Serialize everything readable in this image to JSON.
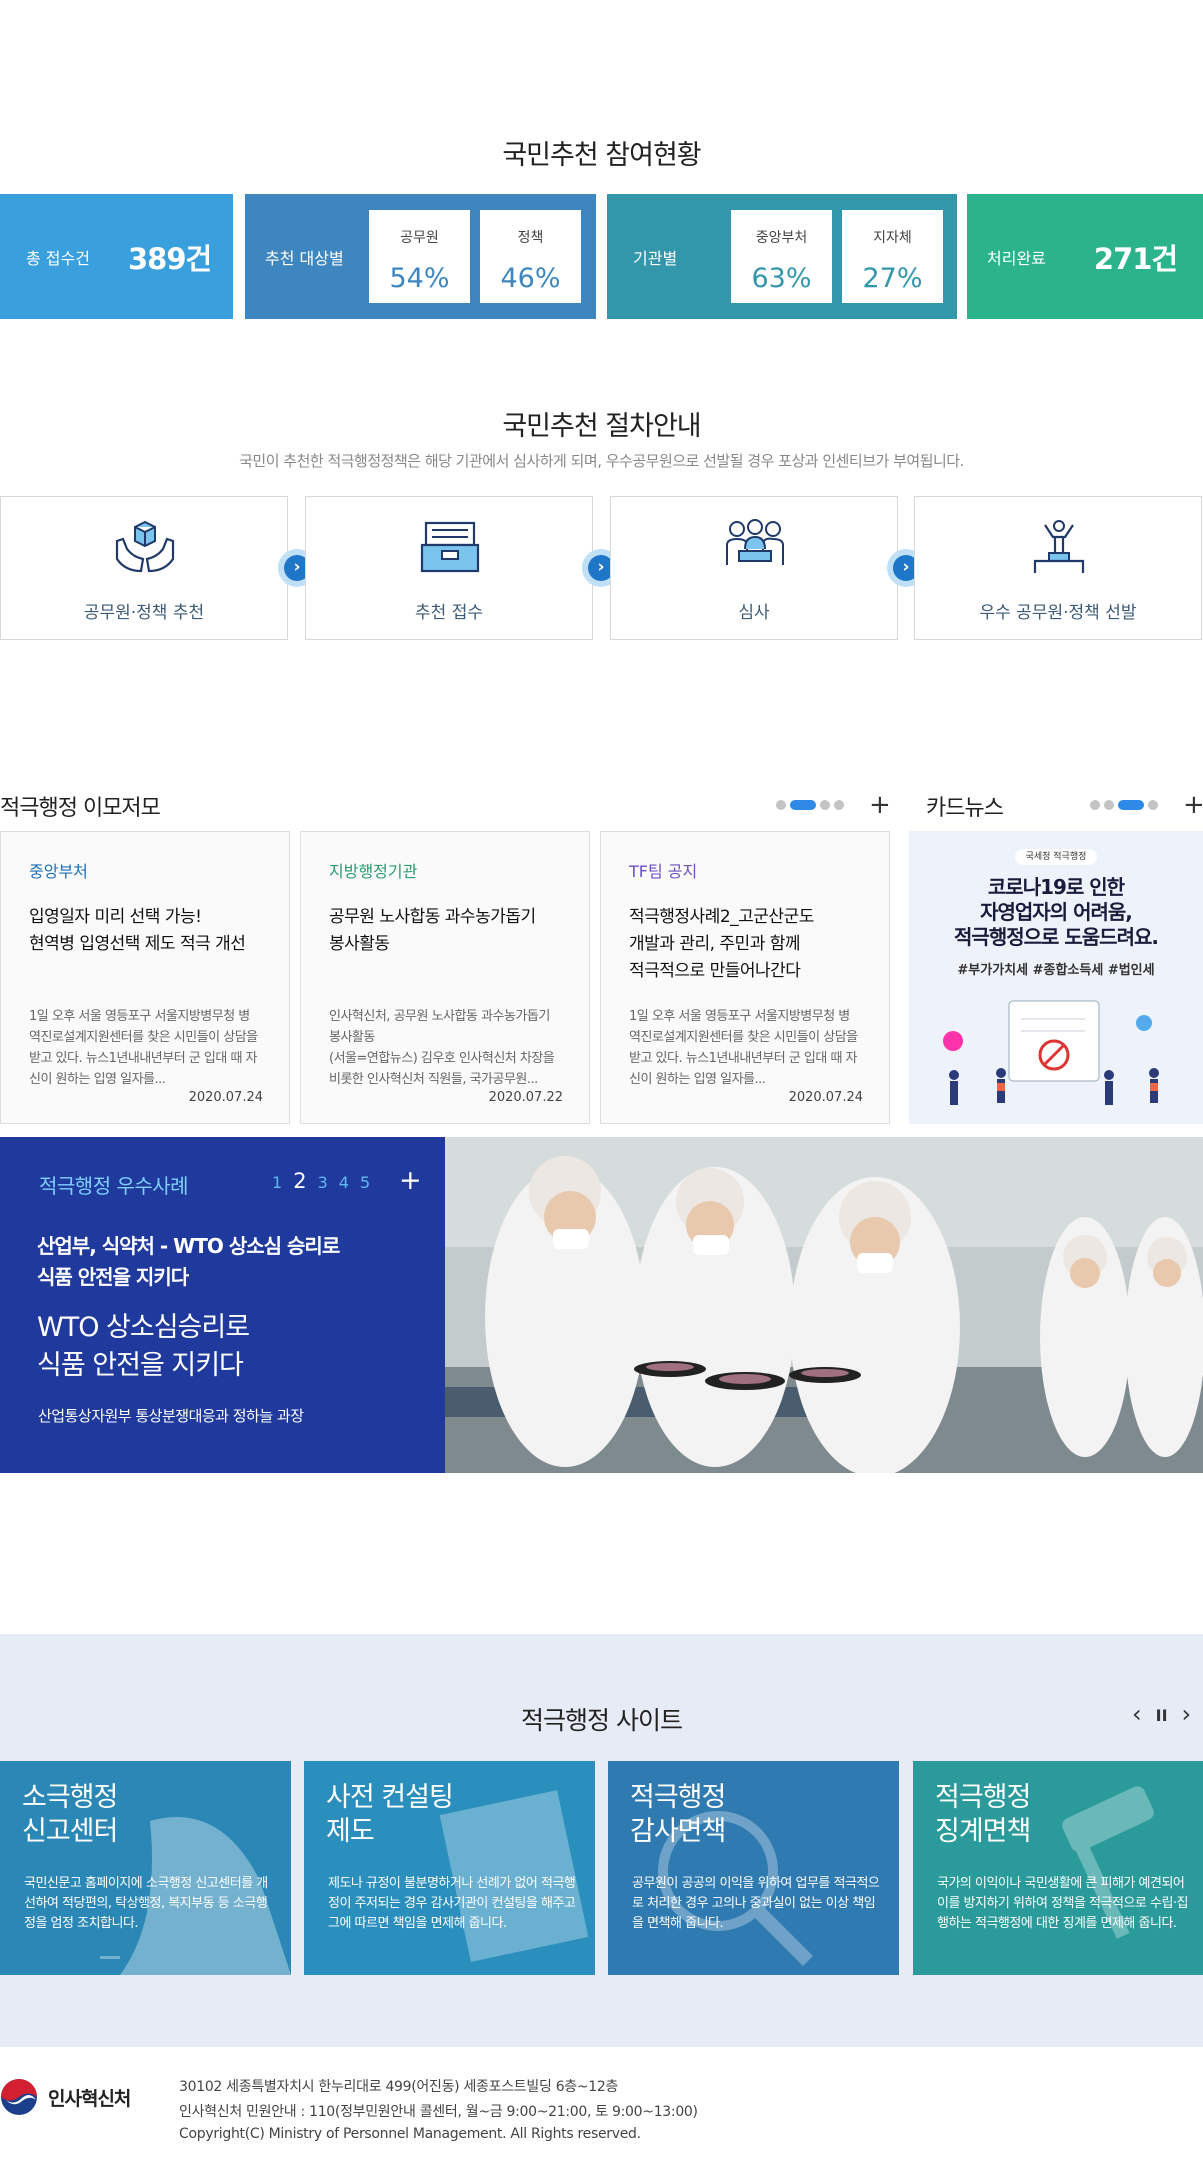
{
  "participation": {
    "title": "국민추천 참여현황",
    "total_label": "총 접수건",
    "total_value": "389건",
    "target_label": "추천 대상별",
    "target_a_label": "공무원",
    "target_a_value": "54%",
    "target_b_label": "정책",
    "target_b_value": "46%",
    "org_label": "기관별",
    "org_a_label": "중앙부처",
    "org_a_value": "63%",
    "org_b_label": "지자체",
    "org_b_value": "27%",
    "done_label": "처리완료",
    "done_value": "271건",
    "colors": {
      "total": "#3a9fdd",
      "target": "#3e86c0",
      "org": "#3397ab",
      "done": "#2bb38c"
    }
  },
  "procedure": {
    "title": "국민추천 절차안내",
    "subtitle": "국민이 추천한 적극행정정책은 해당 기관에서 심사하게 되며, 우수공무원으로 선발될 경우 포상과 인센티브가 부여됩니다.",
    "steps": [
      {
        "label": "공무원·정책 추천",
        "icon": "hands-box-icon"
      },
      {
        "label": "추천 접수",
        "icon": "inbox-icon"
      },
      {
        "label": "심사",
        "icon": "meeting-icon"
      },
      {
        "label": "우수 공무원·정책 선발",
        "icon": "podium-icon"
      }
    ]
  },
  "board": {
    "title": "적극행정 이모저모",
    "plus": "+",
    "cards": [
      {
        "category": "중앙부처",
        "cat_color": "#1e6fb8",
        "title": "입영일자 미리 선택 가능!\n현역병 입영선택 제도 적극 개선",
        "body": "1일 오후 서울 영등포구 서울지방병무청 병역진로설계지원센터를 찾은 시민들이 상담을 받고 있다. 뉴스1년내내년부터 군 입대 때 자신이 원하는 입영 일자를...",
        "date": "2020.07.24"
      },
      {
        "category": "지방행정기관",
        "cat_color": "#2a9a6e",
        "title": "공무원 노사합동 과수농가돕기\n봉사활동",
        "body": "인사혁신처, 공무원 노사합동 과수농가돕기 봉사활동\n(서울=연합뉴스) 김우호 인사혁신처 차장을 비롯한 인사혁신처 직원들, 국가공무원...",
        "date": "2020.07.22"
      },
      {
        "category": "TF팀 공지",
        "cat_color": "#6a4fc4",
        "title": "적극행정사례2_고군산군도\n개발과 관리, 주민과 함께\n적극적으로 만들어나간다",
        "body": "1일 오후 서울 영등포구 서울지방병무청 병역진로설계지원센터를 찾은 시민들이 상담을 받고 있다. 뉴스1년내내년부터 군 입대 때 자신이 원하는 입영 일자를...",
        "date": "2020.07.24"
      }
    ]
  },
  "cardnews": {
    "title": "카드뉴스",
    "plus": "+",
    "tag": "국세청 적극행정",
    "headline": "코로나19로 인한\n자영업자의 어려움,\n적극행정으로 도움드려요.",
    "hashtags": "#부가가치세 #종합소득세 #법인세"
  },
  "best_case": {
    "title": "적극행정 우수사례",
    "pages": [
      "1",
      "2",
      "3",
      "4",
      "5"
    ],
    "current_page": "2",
    "plus": "+",
    "headline": "산업부, 식약처 - WTO 상소심 승리로\n식품 안전을 지키다",
    "subhead": "WTO 상소심승리로\n식품 안전을 지키다",
    "dept": "산업통상자원부 통상분쟁대응과 정하늘 과장"
  },
  "sites": {
    "title": "적극행정 사이트",
    "controls": {
      "prev": "‹",
      "pause": "II",
      "next": "›"
    },
    "items": [
      {
        "title": "소극행정\n신고센터",
        "desc": "국민신문고 홈페이지에 소극행정 신고센터를 개선하여 적당편의, 탁상행정, 복지부동 등 소극행정을 엄정 조치합니다.",
        "bg": "#2a87b6"
      },
      {
        "title": "사전 컨설팅\n제도",
        "desc": "제도나 규정이 불분명하거나 선례가 없어 적극행정이 주저되는 경우 감사기관이 컨설팅을 해주고 그에 따르면 책임을 면제해 줍니다.",
        "bg": "#2a8fbd"
      },
      {
        "title": "적극행정\n감사면책",
        "desc": "공무원이 공공의 이익을 위하여 업무를 적극적으로 처리한 경우 고의나 중과실이 없는 이상 책임을 면책해 줍니다.",
        "bg": "#2f7ab0"
      },
      {
        "title": "적극행정\n징계면책",
        "desc": "국가의 이익이나 국민생활에 큰 피해가 예견되어 이를 방지하기 위하여 정책을 적극적으로 수립·집행하는 적극행정에 대한 징계를 면제해 줍니다.",
        "bg": "#2a9b9a"
      }
    ]
  },
  "footer": {
    "logo_text": "인사혁신처",
    "address": "30102 세종특별자치시 한누리대로 499(어진동) 세종포스트빌딩 6층~12층",
    "contact": "인사혁신처 민원안내 : 110(정부민원안내 콜센터, 월~금 9:00~21:00, 토 9:00~13:00)",
    "copyright": "Copyright(C) Ministry of Personnel Management. All Rights reserved."
  }
}
